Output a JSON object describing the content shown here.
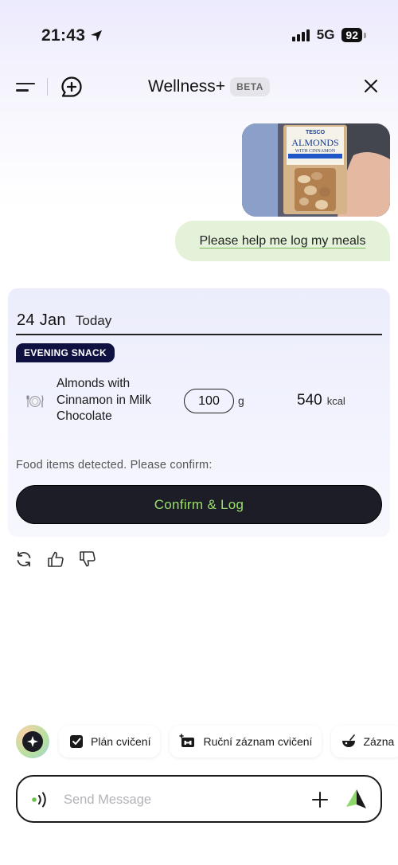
{
  "status_bar": {
    "time": "21:43",
    "network": "5G",
    "battery": "92"
  },
  "header": {
    "title": "Wellness+",
    "badge": "BETA"
  },
  "conversation": {
    "user_message": "Please help me log my meals",
    "photo": {
      "brand": "TESCO",
      "product_line1": "ALMONDS",
      "product_line2": "WITH CINNAMON"
    }
  },
  "meal_card": {
    "date": "24 Jan",
    "day_label": "Today",
    "meal_type": "EVENING SNACK",
    "items": [
      {
        "name": "Almonds with Cinnamon in Milk Chocolate",
        "quantity": "100",
        "unit": "g",
        "calories": "540",
        "calorie_unit": "kcal"
      }
    ],
    "detected_text": "Food items detected. Please confirm:",
    "confirm_label": "Confirm & Log"
  },
  "quick_actions": [
    {
      "label": "Plán cvičení",
      "icon": "checkbox-icon"
    },
    {
      "label": "Ruční záznam cvičení",
      "icon": "dumbbell-icon"
    },
    {
      "label": "Zázna",
      "icon": "bowl-icon"
    }
  ],
  "composer": {
    "placeholder": "Send Message"
  },
  "colors": {
    "accent_green": "#9be06c",
    "badge_navy": "#0f1240",
    "bubble_green": "#e3f2d8",
    "button_dark": "#1c1d26"
  }
}
